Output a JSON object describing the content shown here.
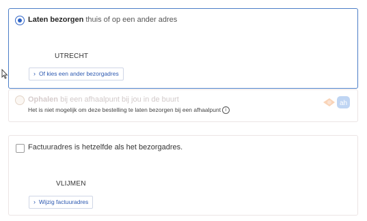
{
  "delivery": {
    "option_bold": "Laten bezorgen",
    "option_rest": " thuis of op een ander adres",
    "city": "UTRECHT",
    "change_label": "Of kies een ander bezorgadres"
  },
  "pickup": {
    "option_bold": "Ophalen",
    "option_rest": " bij een afhaalpunt bij jou in de buurt",
    "note": "Het is niet mogelijk om deze bestelling te laten bezorgen bij een afhaalpunt"
  },
  "invoice": {
    "same_as_delivery_label": "Factuuradres is hetzelfde als het bezorgadres.",
    "city": "VLIJMEN",
    "change_label": "Wijzig factuuradres"
  },
  "icons": {
    "chevron": "chevron-right-icon",
    "info": "info-icon",
    "cursor": "mouse-cursor-icon",
    "pickup_logos": "pickup-partner-logos"
  },
  "colors": {
    "accent": "#2f64c6",
    "border_selected": "#4a7cc7",
    "border_default": "#ebe4e4"
  }
}
